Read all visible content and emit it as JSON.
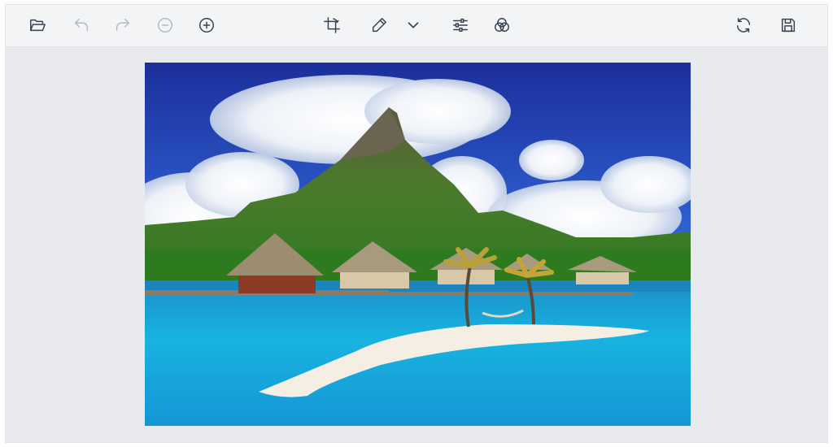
{
  "toolbar": {
    "left": [
      {
        "name": "open-button",
        "icon": "folder-open-icon",
        "enabled": true
      },
      {
        "name": "undo-button",
        "icon": "undo-icon",
        "enabled": false
      },
      {
        "name": "redo-button",
        "icon": "redo-icon",
        "enabled": false
      },
      {
        "name": "zoom-out-button",
        "icon": "zoom-out-icon",
        "enabled": false
      },
      {
        "name": "zoom-in-button",
        "icon": "zoom-in-icon",
        "enabled": true
      }
    ],
    "center": [
      {
        "name": "crop-rotate-button",
        "icon": "crop-rotate-icon"
      },
      {
        "name": "draw-button",
        "icon": "pencil-icon"
      },
      {
        "name": "draw-dropdown-button",
        "icon": "chevron-down-icon"
      },
      {
        "name": "adjust-button",
        "icon": "sliders-icon"
      },
      {
        "name": "filter-button",
        "icon": "filter-circles-icon"
      }
    ],
    "right": [
      {
        "name": "reset-button",
        "icon": "refresh-icon"
      },
      {
        "name": "save-button",
        "icon": "save-icon"
      }
    ]
  },
  "canvas": {
    "image": "tropical-island-overwater-bungalows"
  },
  "colors": {
    "toolbar_bg": "#f3f4f6",
    "canvas_bg": "#e9eaed",
    "icon": "#374151"
  }
}
